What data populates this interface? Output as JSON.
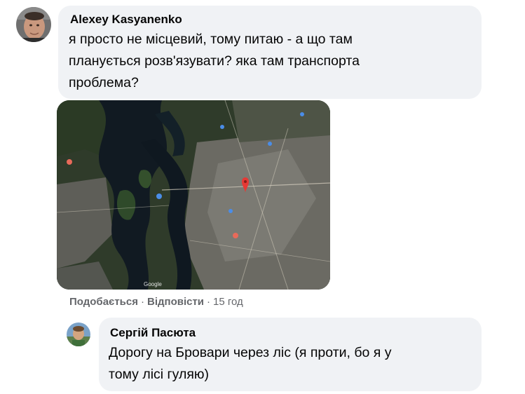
{
  "comment": {
    "author": "Alexey Kasyanenko",
    "lines": [
      "я просто не місцевий, тому питаю - а що там",
      "планується розв'язувати? яка там транспорта",
      "проблема?"
    ],
    "avatar_icon": "profile-photo",
    "attachment": {
      "type": "map-screenshot",
      "watermark": "Google",
      "pin_color": "#e53935"
    },
    "actions": {
      "like": "Подобається",
      "separator": "·",
      "reply": "Відповісти",
      "time": "15 год"
    }
  },
  "reply": {
    "author": "Сергій Пасюта",
    "lines": [
      "Дорогу на Бровари через ліс (я проти, бо я у",
      "тому лісі гуляю)"
    ],
    "avatar_icon": "profile-photo"
  }
}
